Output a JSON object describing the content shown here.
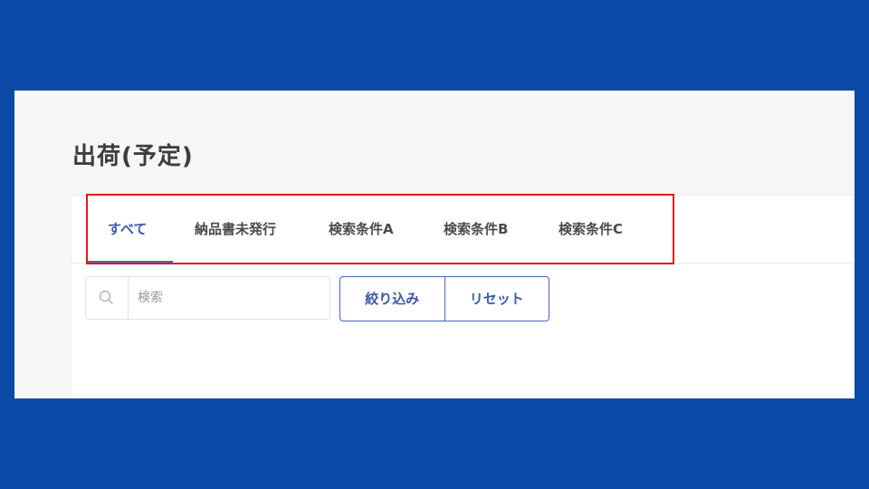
{
  "page": {
    "title": "出荷(予定)"
  },
  "tabs": [
    {
      "label": "すべて",
      "active": true
    },
    {
      "label": "納品書未発行",
      "active": false
    },
    {
      "label": "検索条件A",
      "active": false
    },
    {
      "label": "検索条件B",
      "active": false
    },
    {
      "label": "検索条件C",
      "active": false
    }
  ],
  "search": {
    "placeholder": "検索",
    "value": "",
    "icon": "search-icon"
  },
  "buttons": {
    "filter_label": "絞り込み",
    "reset_label": "リセット"
  },
  "colors": {
    "slide_background": "#0b4aa6",
    "accent": "#3d5aa6",
    "highlight": "#e0161c"
  }
}
